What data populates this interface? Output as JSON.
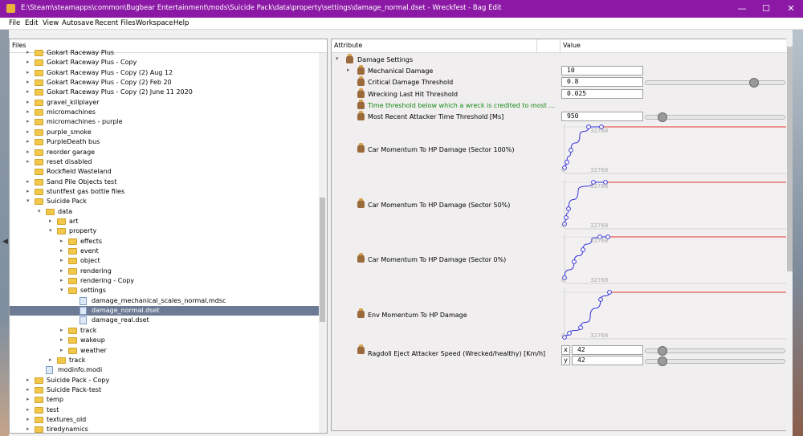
{
  "window": {
    "title": "E:\\Steam\\steamapps\\common\\Bugbear Entertainment\\mods\\Suicide Pack\\data\\property\\settings\\damage_normal.dset - Wreckfest - Bag Edit",
    "minimize_glyph": "—",
    "maximize_glyph": "☐",
    "close_glyph": "✕",
    "title_color": "#8c19a6"
  },
  "menu": [
    "File",
    "Edit",
    "View",
    "Autosave",
    "Recent Files",
    "Workspace",
    "Help"
  ],
  "files_panel": {
    "header": "Files",
    "collapse_arrow": "◀",
    "items": [
      {
        "label": "Gokart Raceway Plus",
        "depth": 0,
        "icon": "folder-icon",
        "expand": "▸"
      },
      {
        "label": "Gokart Raceway Plus - Copy",
        "depth": 0,
        "icon": "folder-icon",
        "expand": "▸"
      },
      {
        "label": "Gokart Raceway Plus - Copy (2) Aug 12",
        "depth": 0,
        "icon": "folder-icon",
        "expand": "▸"
      },
      {
        "label": "Gokart Raceway Plus - Copy (2) Feb 20",
        "depth": 0,
        "icon": "folder-icon",
        "expand": "▸"
      },
      {
        "label": "Gokart Raceway Plus - Copy (2) June 11 2020",
        "depth": 0,
        "icon": "folder-icon",
        "expand": "▸"
      },
      {
        "label": "gravel_killplayer",
        "depth": 0,
        "icon": "folder-icon",
        "expand": "▸"
      },
      {
        "label": "micromachines",
        "depth": 0,
        "icon": "folder-icon",
        "expand": "▸"
      },
      {
        "label": "micromachines - purple",
        "depth": 0,
        "icon": "folder-icon",
        "expand": "▸"
      },
      {
        "label": "purple_smoke",
        "depth": 0,
        "icon": "folder-icon",
        "expand": "▸"
      },
      {
        "label": "PurpleDeath bus",
        "depth": 0,
        "icon": "folder-icon",
        "expand": "▸"
      },
      {
        "label": "reorder garage",
        "depth": 0,
        "icon": "folder-icon",
        "expand": "▸"
      },
      {
        "label": "reset disabled",
        "depth": 0,
        "icon": "folder-icon",
        "expand": "▸"
      },
      {
        "label": "Rockfield Wasteland",
        "depth": 0,
        "icon": "folder-icon",
        "expand": ""
      },
      {
        "label": "Sand Pile Objects test",
        "depth": 0,
        "icon": "folder-icon",
        "expand": "▸"
      },
      {
        "label": "stuntfest gas bottle files",
        "depth": 0,
        "icon": "folder-icon",
        "expand": "▸"
      },
      {
        "label": "Suicide Pack",
        "depth": 0,
        "icon": "folder-icon",
        "expand": "▾"
      },
      {
        "label": "data",
        "depth": 1,
        "icon": "folder-icon",
        "expand": "▾"
      },
      {
        "label": "art",
        "depth": 2,
        "icon": "folder-icon",
        "expand": "▸"
      },
      {
        "label": "property",
        "depth": 2,
        "icon": "folder-icon",
        "expand": "▾"
      },
      {
        "label": "effects",
        "depth": 3,
        "icon": "folder-icon",
        "expand": "▸"
      },
      {
        "label": "event",
        "depth": 3,
        "icon": "folder-icon",
        "expand": "▸"
      },
      {
        "label": "object",
        "depth": 3,
        "icon": "folder-icon",
        "expand": "▸"
      },
      {
        "label": "rendering",
        "depth": 3,
        "icon": "folder-icon",
        "expand": "▸"
      },
      {
        "label": "rendering - Copy",
        "depth": 3,
        "icon": "folder-icon",
        "expand": "▸"
      },
      {
        "label": "settings",
        "depth": 3,
        "icon": "folder-icon",
        "expand": "▾"
      },
      {
        "label": "damage_mechanical_scales_normal.mdsc",
        "depth": 4,
        "icon": "file-icon",
        "expand": ""
      },
      {
        "label": "damage_normal.dset",
        "depth": 4,
        "icon": "file-icon",
        "expand": "",
        "selected": true
      },
      {
        "label": "damage_real.dset",
        "depth": 4,
        "icon": "file-icon",
        "expand": ""
      },
      {
        "label": "track",
        "depth": 3,
        "icon": "folder-icon",
        "expand": "▸"
      },
      {
        "label": "wakeup",
        "depth": 3,
        "icon": "folder-icon",
        "expand": "▸"
      },
      {
        "label": "weather",
        "depth": 3,
        "icon": "folder-icon",
        "expand": "▸"
      },
      {
        "label": "track",
        "depth": 2,
        "icon": "folder-icon",
        "expand": "▸"
      },
      {
        "label": "modinfo.modi",
        "depth": 1,
        "icon": "file-icon",
        "expand": ""
      },
      {
        "label": "Suicide Pack - Copy",
        "depth": 0,
        "icon": "folder-icon",
        "expand": "▸"
      },
      {
        "label": "Suicide Pack-test",
        "depth": 0,
        "icon": "folder-icon",
        "expand": "▸"
      },
      {
        "label": "temp",
        "depth": 0,
        "icon": "folder-icon",
        "expand": "▸"
      },
      {
        "label": "test",
        "depth": 0,
        "icon": "folder-icon",
        "expand": "▸"
      },
      {
        "label": "textures_old",
        "depth": 0,
        "icon": "folder-icon",
        "expand": "▸"
      },
      {
        "label": "tiredynamics",
        "depth": 0,
        "icon": "folder-icon",
        "expand": "▸"
      }
    ]
  },
  "attributes_panel": {
    "header_attribute": "Attribute",
    "header_value": "Value",
    "group": {
      "label": "Damage Settings",
      "expand": "▾"
    },
    "rows": [
      {
        "label": "Mechanical Damage",
        "expand": "▸",
        "value": "10"
      },
      {
        "label": "Critical Damage Threshold",
        "value": "0.8",
        "slider_fraction": 0.79
      },
      {
        "label": "Wrecking Last Hit Threshold",
        "value": "0.025"
      },
      {
        "label": "Time threshold below which a wreck is credited to most ...",
        "color": "#138a15"
      },
      {
        "label": "Most Recent Attacker Time Threshold [Ms]",
        "value": "950",
        "slider_fraction": 0.09
      }
    ],
    "curves": [
      {
        "label": "Car Momentum To HP Damage (Sector 100%)",
        "y_top": "32768",
        "x_label": "32768",
        "origin": "0"
      },
      {
        "label": "Car Momentum To HP Damage (Sector 50%)",
        "y_top": "32768",
        "x_label": "32768",
        "origin": "0"
      },
      {
        "label": "Car Momentum To HP Damage (Sector 0%)",
        "y_top": "32768",
        "x_label": "32768",
        "origin": "0"
      },
      {
        "label": "Env Momentum To HP Damage",
        "y_top": "",
        "x_label": "32768",
        "origin": "0"
      }
    ],
    "ragdoll": {
      "label": "Ragdoll Eject Attacker Speed (Wrecked/healthy) [Km/h]",
      "x_axis": "x",
      "y_axis": "y",
      "x_value": "42",
      "y_value": "42",
      "x_slider_fraction": 0.09,
      "y_slider_fraction": 0.09
    }
  }
}
